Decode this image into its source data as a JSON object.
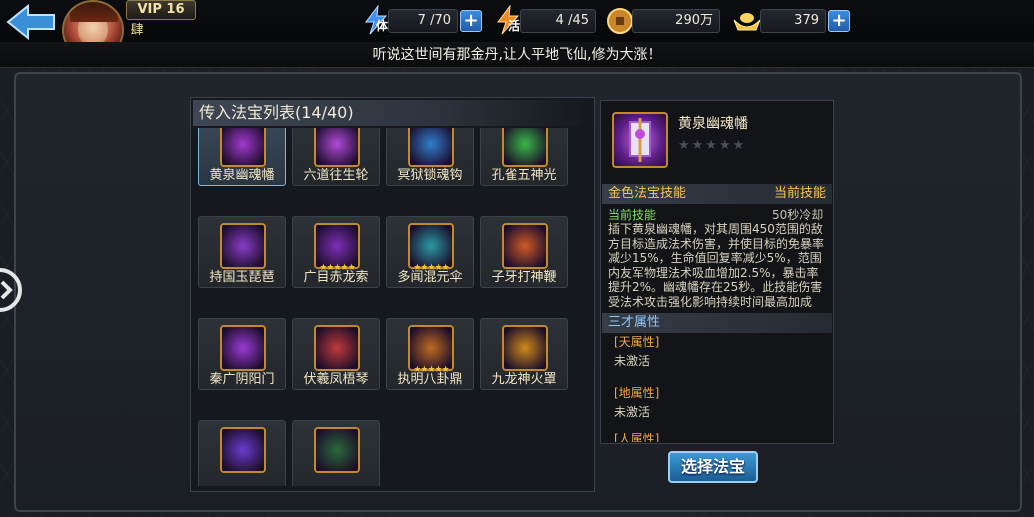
{
  "header": {
    "vip_label": "VIP 16",
    "rank_glyph": "肆",
    "resources": [
      {
        "icon": "stamina-icon",
        "label": "体",
        "value": "7 /70",
        "has_plus": true
      },
      {
        "icon": "vitality-icon",
        "label": "活",
        "value": "4 /45",
        "has_plus": false
      },
      {
        "icon": "copper-coin-icon",
        "label": "",
        "value": "290万",
        "has_plus": false
      },
      {
        "icon": "gold-ingot-icon",
        "label": "",
        "value": "379",
        "has_plus": true
      }
    ]
  },
  "notice": "听说这世间有那金丹,让人平地飞仙,修为大涨！",
  "list": {
    "title": "传入法宝列表(14/40)",
    "items": [
      {
        "name": "黄泉幽魂幡",
        "stars": 0,
        "selected": true,
        "color": "#a23ad0"
      },
      {
        "name": "六道往生轮",
        "stars": 0,
        "selected": false,
        "color": "#b04ad8"
      },
      {
        "name": "冥狱锁魂钩",
        "stars": 0,
        "selected": false,
        "color": "#2f7fd0"
      },
      {
        "name": "孔雀五神光",
        "stars": 0,
        "selected": false,
        "color": "#3ab848"
      },
      {
        "name": "持国玉琵琶",
        "stars": 0,
        "selected": false,
        "color": "#8a3cc8"
      },
      {
        "name": "广目赤龙索",
        "stars": 5,
        "selected": false,
        "color": "#7d2fb8"
      },
      {
        "name": "多闻混元伞",
        "stars": 5,
        "selected": false,
        "color": "#2a9aa6"
      },
      {
        "name": "子牙打神鞭",
        "stars": 0,
        "selected": false,
        "color": "#d05a28"
      },
      {
        "name": "秦广阴阳门",
        "stars": 0,
        "selected": false,
        "color": "#9a3ad6"
      },
      {
        "name": "伏羲凤梧琴",
        "stars": 0,
        "selected": false,
        "color": "#c03a3a"
      },
      {
        "name": "执明八卦鼎",
        "stars": 5,
        "selected": false,
        "color": "#c06a22"
      },
      {
        "name": "九龙神火罩",
        "stars": 0,
        "selected": false,
        "color": "#d08a1a"
      },
      {
        "name": "",
        "stars": 0,
        "selected": false,
        "color": "#6a3cd0"
      },
      {
        "name": "",
        "stars": 0,
        "selected": false,
        "color": "#2a6a3a"
      }
    ]
  },
  "detail": {
    "name": "黄泉幽魂幡",
    "stars": "★★★★★",
    "skill_section": "金色法宝技能",
    "skill_section_right": "当前技能",
    "current_skill": "当前技能",
    "cooldown": "50秒冷却",
    "description": "插下黄泉幽魂幡，对其周围450范围的敌方目标造成法术伤害，并使目标的免暴率减少15%，生命值回复率减少5%，范围内友军物理法术吸血增加2.5%，暴击率提升2%。幽魂幡存在25秒。此技能伤害受法术攻击强化影响持续时间最高加成",
    "attr_section": "三才属性",
    "attrs": [
      {
        "label": "[天属性]",
        "value": "未激活"
      },
      {
        "label": "[地属性]",
        "value": "未激活"
      },
      {
        "label": "[人属性]",
        "value": ""
      }
    ],
    "select_button": "选择法宝"
  },
  "colors": {
    "accent_blue": "#3b9ad6",
    "gold_text": "#f6c64c",
    "border_gold": "#c48a2a"
  }
}
